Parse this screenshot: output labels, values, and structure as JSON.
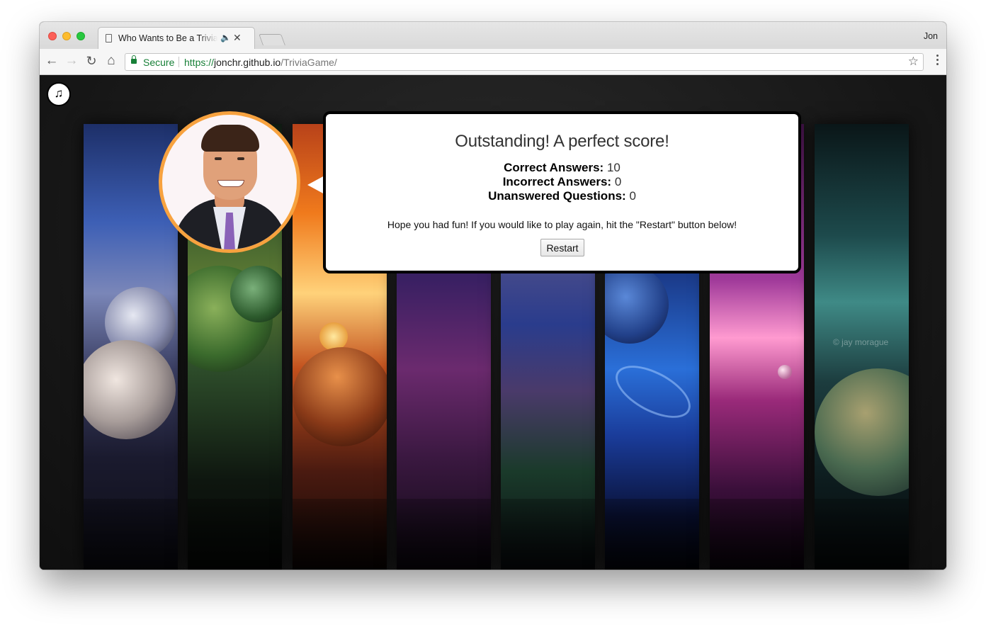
{
  "browser": {
    "tab_title": "Who Wants to Be a Trivia Master",
    "profile_name": "Jon",
    "security_label": "Secure",
    "url": {
      "scheme": "https://",
      "host": "jonchr.github.io",
      "path": "/TriviaGame/"
    }
  },
  "icons": {
    "music": "music-note-icon",
    "back": "arrow-left-icon",
    "forward": "arrow-right-icon",
    "reload": "reload-icon",
    "home": "home-icon",
    "lock": "lock-icon",
    "star": "star-icon",
    "menu": "kebab-menu-icon",
    "audio": "speaker-icon",
    "close": "close-icon"
  },
  "glyphs": {
    "back": "←",
    "forward": "→",
    "reload": "↻",
    "home": "⌂",
    "star": "☆",
    "music": "♫",
    "audio": "🔈",
    "close": "✕"
  },
  "game": {
    "watermark": "© jay morague",
    "result": {
      "title": "Outstanding! A perfect score!",
      "stats": [
        {
          "label": "Correct Answers:",
          "value": "10"
        },
        {
          "label": "Incorrect Answers:",
          "value": "0"
        },
        {
          "label": "Unanswered Questions:",
          "value": "0"
        }
      ],
      "message": "Hope you had fun! If you would like to play again, hit the \"Restart\" button below!",
      "restart_label": "Restart"
    }
  },
  "colors": {
    "avatar_border": "#f7a23f",
    "secure_green": "#188038",
    "bubble_border": "#000000"
  }
}
